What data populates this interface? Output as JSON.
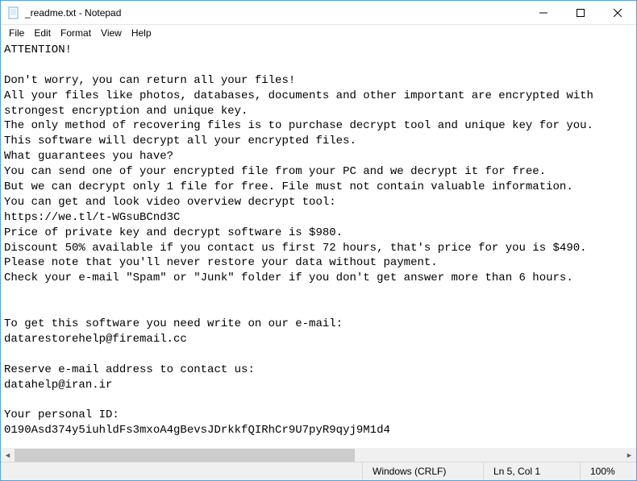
{
  "titlebar": {
    "title": "_readme.txt - Notepad"
  },
  "menu": {
    "file": "File",
    "edit": "Edit",
    "format": "Format",
    "view": "View",
    "help": "Help"
  },
  "content": {
    "text": "ATTENTION!\n\nDon't worry, you can return all your files!\nAll your files like photos, databases, documents and other important are encrypted with strongest encryption and unique key.\nThe only method of recovering files is to purchase decrypt tool and unique key for you.\nThis software will decrypt all your encrypted files.\nWhat guarantees you have?\nYou can send one of your encrypted file from your PC and we decrypt it for free.\nBut we can decrypt only 1 file for free. File must not contain valuable information.\nYou can get and look video overview decrypt tool:\nhttps://we.tl/t-WGsuBCnd3C\nPrice of private key and decrypt software is $980.\nDiscount 50% available if you contact us first 72 hours, that's price for you is $490.\nPlease note that you'll never restore your data without payment.\nCheck your e-mail \"Spam\" or \"Junk\" folder if you don't get answer more than 6 hours.\n\n\nTo get this software you need write on our e-mail:\ndatarestorehelp@firemail.cc\n\nReserve e-mail address to contact us:\ndatahelp@iran.ir\n\nYour personal ID:\n0190Asd374y5iuhldFs3mxoA4gBevsJDrkkfQIRhCr9U7pyR9qyj9M1d4"
  },
  "statusbar": {
    "encoding": "Windows (CRLF)",
    "position": "Ln 5, Col 1",
    "zoom": "100%"
  }
}
